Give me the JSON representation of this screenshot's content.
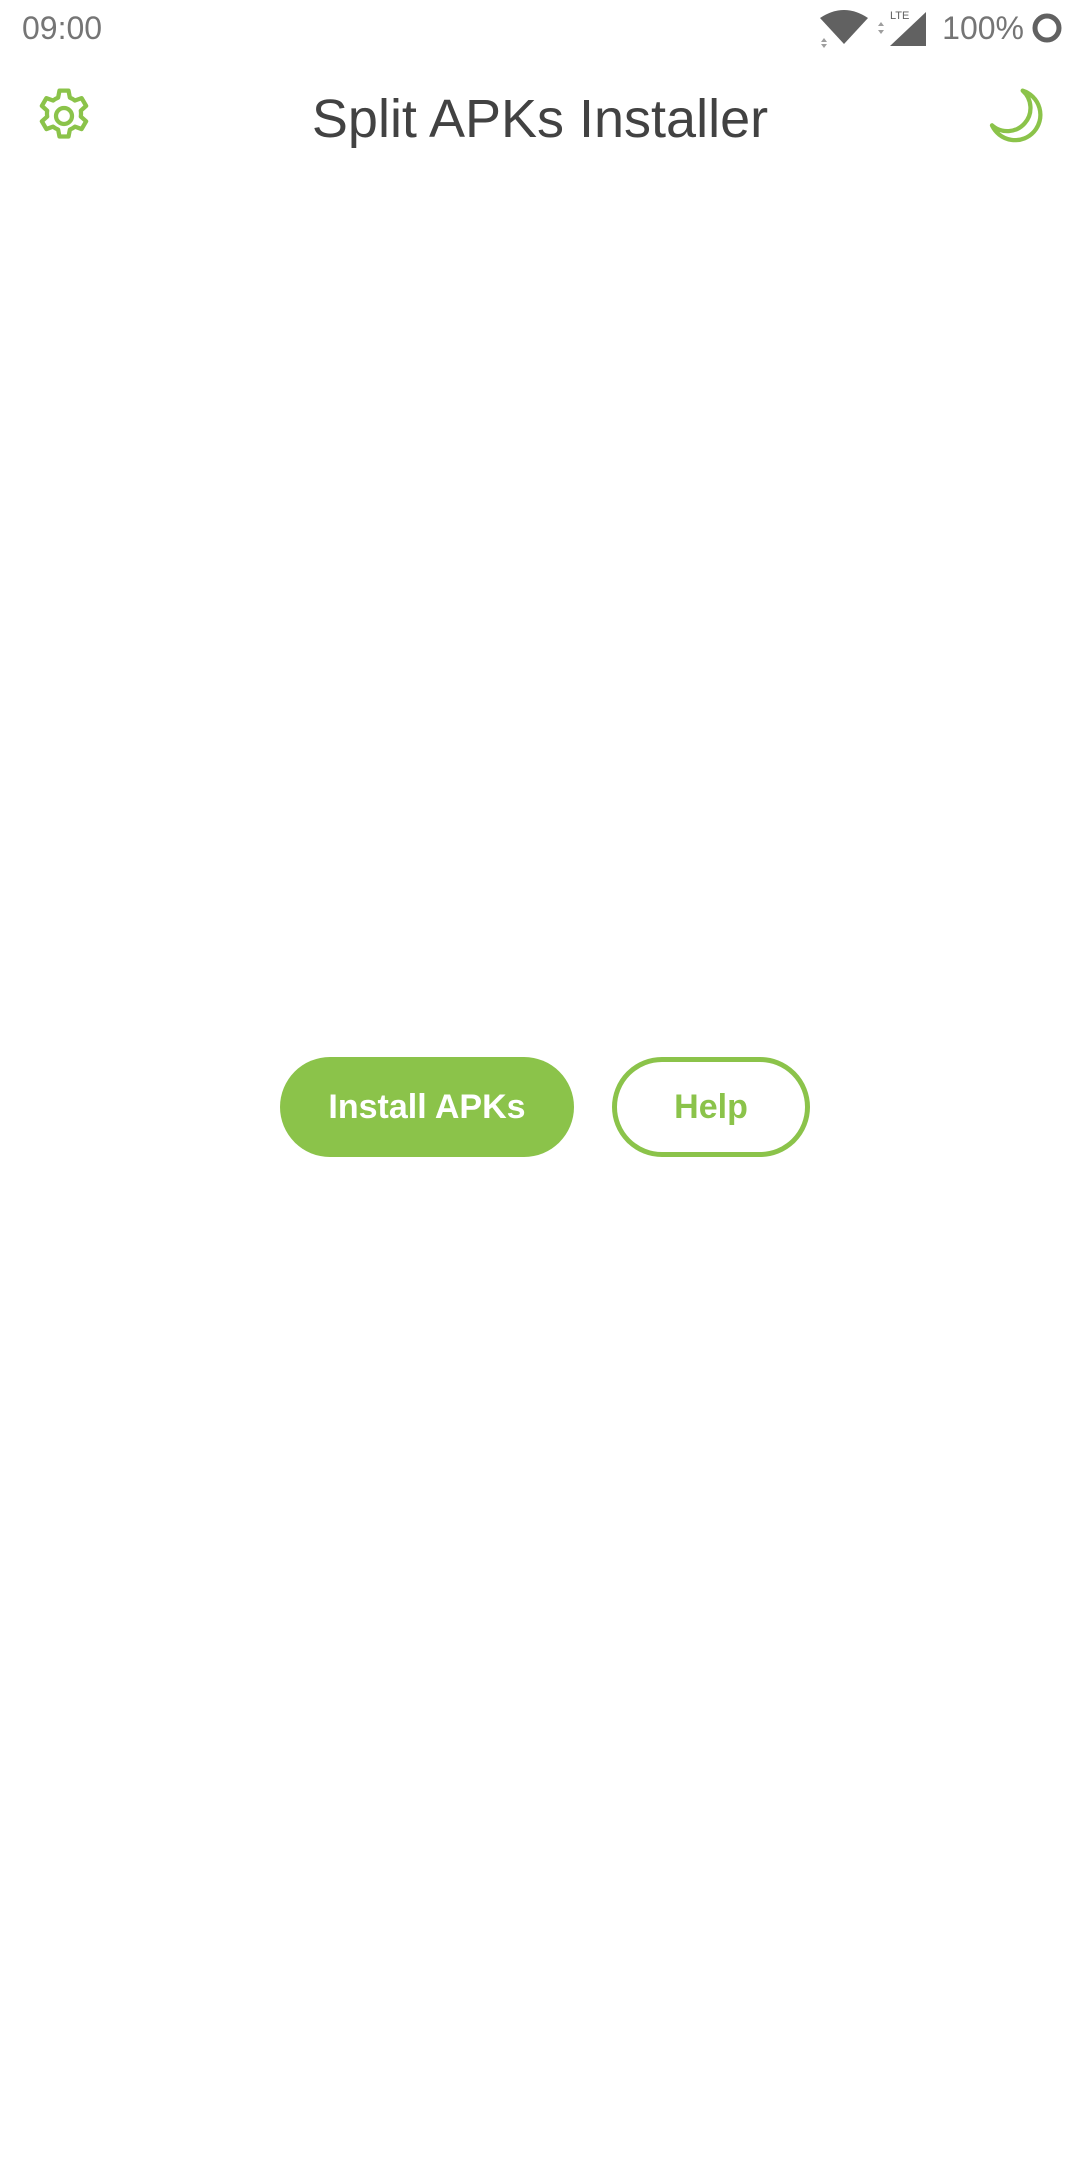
{
  "status_bar": {
    "time": "09:00",
    "network_label": "LTE",
    "battery": "100%",
    "icons": [
      "wifi-icon",
      "lte-signal-icon",
      "battery-saver-icon"
    ]
  },
  "app_bar": {
    "title": "Split APKs Installer",
    "left_icon": "gear-icon",
    "right_icon": "moon-icon"
  },
  "actions": {
    "install_label": "Install APKs",
    "help_label": "Help"
  },
  "colors": {
    "accent": "#8bc34a",
    "title_text": "#424242",
    "status_text": "#757575",
    "background": "#ffffff"
  }
}
